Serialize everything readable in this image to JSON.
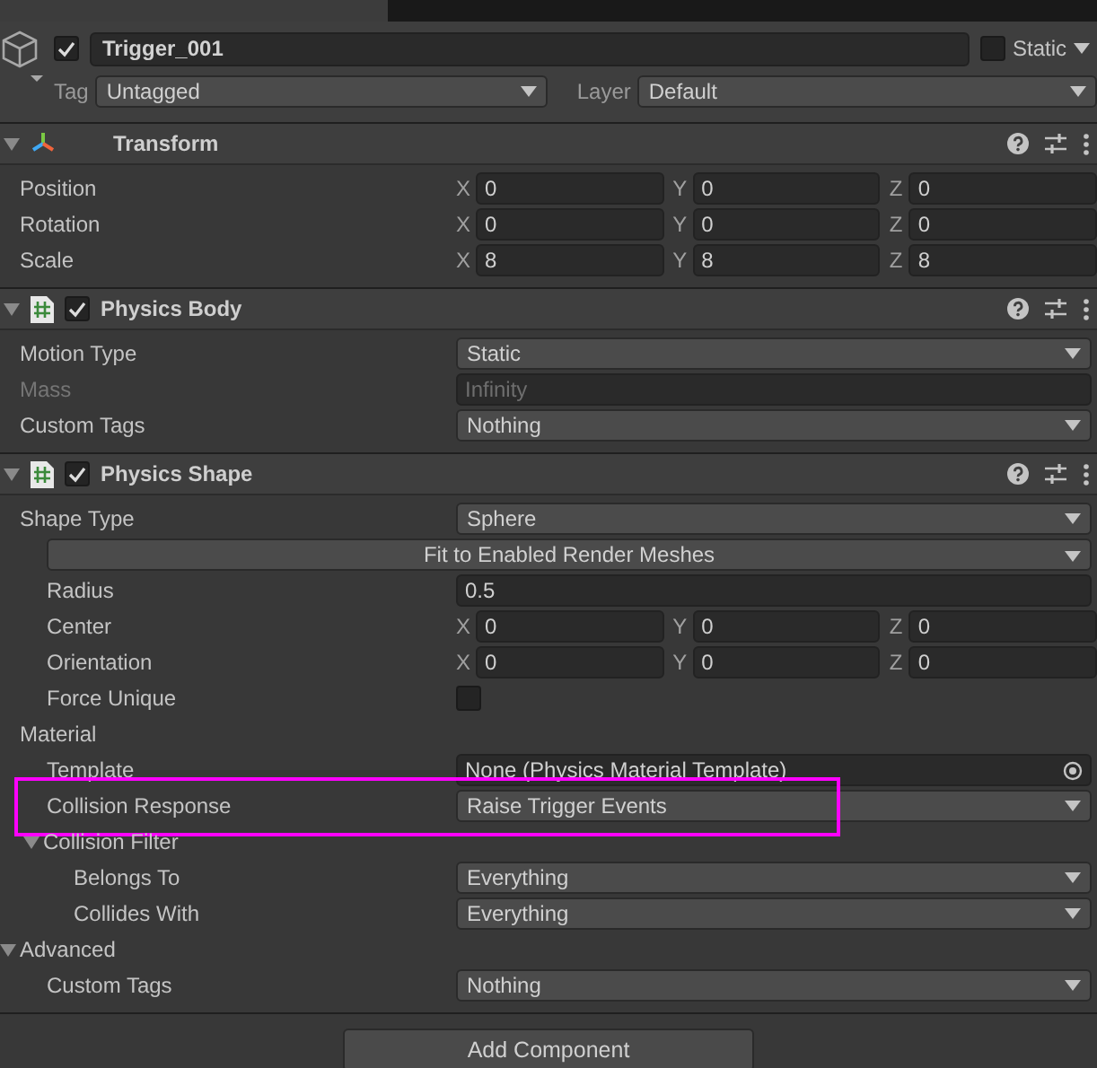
{
  "object": {
    "active": true,
    "name": "Trigger_001",
    "static": false,
    "static_label": "Static",
    "tag_label": "Tag",
    "tag": "Untagged",
    "layer_label": "Layer",
    "layer": "Default"
  },
  "components": [
    {
      "title": "Transform",
      "kind": "transform",
      "expanded": true,
      "rows": [
        {
          "kind": "vector3",
          "label": "Position",
          "values": [
            {
              "axis": "X",
              "value": "0"
            },
            {
              "axis": "Y",
              "value": "0"
            },
            {
              "axis": "Z",
              "value": "0"
            }
          ]
        },
        {
          "kind": "vector3",
          "label": "Rotation",
          "values": [
            {
              "axis": "X",
              "value": "0"
            },
            {
              "axis": "Y",
              "value": "0"
            },
            {
              "axis": "Z",
              "value": "0"
            }
          ]
        },
        {
          "kind": "vector3",
          "label": "Scale",
          "values": [
            {
              "axis": "X",
              "value": "8"
            },
            {
              "axis": "Y",
              "value": "8"
            },
            {
              "axis": "Z",
              "value": "8"
            }
          ]
        }
      ]
    },
    {
      "title": "Physics Body",
      "kind": "script",
      "enabled": true,
      "expanded": true,
      "rows": [
        {
          "kind": "dropdown",
          "label": "Motion Type",
          "value": "Static"
        },
        {
          "kind": "field",
          "label": "Mass",
          "value": "Infinity",
          "disabled": true
        },
        {
          "kind": "dropdown",
          "label": "Custom Tags",
          "value": "Nothing"
        }
      ]
    },
    {
      "title": "Physics Shape",
      "kind": "script",
      "enabled": true,
      "expanded": true,
      "rows": [
        {
          "kind": "dropdown",
          "label": "Shape Type",
          "value": "Sphere",
          "children": [
            {
              "kind": "wide_dropdown",
              "value": "Fit to Enabled Render Meshes"
            },
            {
              "kind": "field",
              "label": "Radius",
              "value": "0.5",
              "disabled": false
            },
            {
              "kind": "vector3",
              "label": "Center",
              "values": [
                {
                  "axis": "X",
                  "value": "0"
                },
                {
                  "axis": "Y",
                  "value": "0"
                },
                {
                  "axis": "Z",
                  "value": "0"
                }
              ]
            },
            {
              "kind": "vector3",
              "label": "Orientation",
              "values": [
                {
                  "axis": "X",
                  "value": "0"
                },
                {
                  "axis": "Y",
                  "value": "0"
                },
                {
                  "axis": "Z",
                  "value": "0"
                }
              ]
            },
            {
              "kind": "checkbox",
              "label": "Force Unique",
              "checked": false
            }
          ]
        },
        {
          "kind": "section",
          "label": "Material",
          "children": [
            {
              "kind": "object",
              "label": "Template",
              "value": "None (Physics Material Template)"
            },
            {
              "kind": "dropdown",
              "label": "Collision Response",
              "value": "Raise Trigger Events",
              "highlighted": true
            },
            {
              "kind": "foldout",
              "label": "Collision Filter",
              "expanded": true,
              "children": [
                {
                  "kind": "dropdown",
                  "label": "Belongs To",
                  "value": "Everything"
                },
                {
                  "kind": "dropdown",
                  "label": "Collides With",
                  "value": "Everything"
                }
              ]
            }
          ]
        },
        {
          "kind": "foldout",
          "label": "Advanced",
          "expanded": true,
          "children": [
            {
              "kind": "dropdown",
              "label": "Custom Tags",
              "value": "Nothing"
            }
          ]
        }
      ]
    }
  ],
  "add_button": "Add Component"
}
